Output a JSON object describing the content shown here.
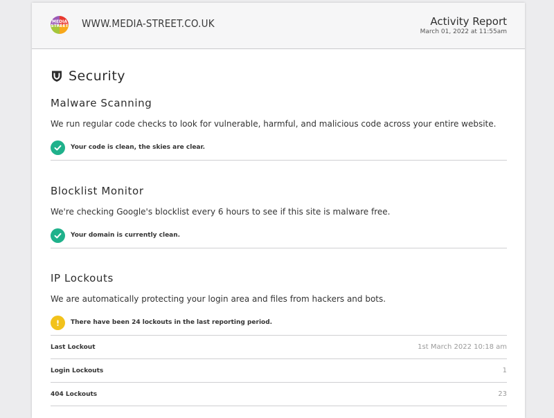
{
  "header": {
    "logo_text": "MEDIA STREET",
    "site_name": "WWW.MEDIA-STREET.CO.UK",
    "report_title": "Activity Report",
    "report_date": "March 01, 2022 at 11:55am"
  },
  "section": {
    "title": "Security",
    "icon": "shield-icon"
  },
  "malware": {
    "title": "Malware Scanning",
    "description": "We run regular code checks to look for vulnerable, harmful, and malicious code across your entire website.",
    "status_icon": "check-icon",
    "status_color": "#1fb18b",
    "status": "Your code is clean, the skies are clear."
  },
  "blocklist": {
    "title": "Blocklist Monitor",
    "description": "We're checking Google's blocklist every 6 hours to see if this site is malware free.",
    "status_icon": "check-icon",
    "status_color": "#1fb18b",
    "status": "Your domain is currently clean."
  },
  "lockouts": {
    "title": "IP Lockouts",
    "description": "We are automatically protecting your login area and files from hackers and bots.",
    "status_icon": "warning-icon",
    "status_color": "#f2c21b",
    "status": "There have been 24 lockouts in the last reporting period.",
    "rows": [
      {
        "label": "Last Lockout",
        "value": "1st March 2022 10:18 am"
      },
      {
        "label": "Login Lockouts",
        "value": "1"
      },
      {
        "label": "404 Lockouts",
        "value": "23"
      }
    ]
  }
}
